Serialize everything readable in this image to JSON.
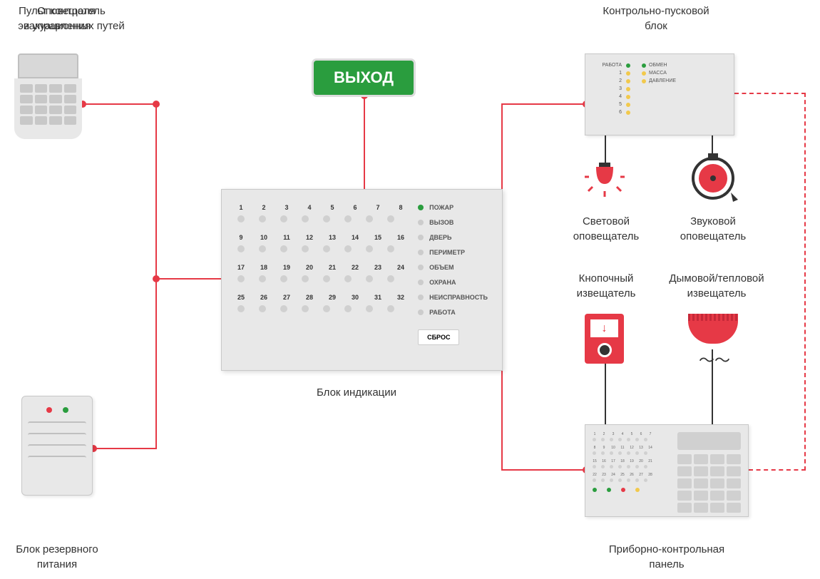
{
  "labels": {
    "control_panel_top": "Пульт контроля",
    "control_panel_top2": "и управления",
    "evac_notifier1": "Оповещатель",
    "evac_notifier2": "эвакуационных путей",
    "launch_block1": "Контрольно-пусковой",
    "launch_block2": "блок",
    "indication_block": "Блок индикации",
    "backup_power1": "Блок резервного",
    "backup_power2": "питания",
    "light_notifier1": "Световой",
    "light_notifier2": "оповещатель",
    "sound_notifier1": "Звуковой",
    "sound_notifier2": "оповещатель",
    "button_detector1": "Кнопочный",
    "button_detector2": "извещатель",
    "smoke_detector1": "Дымовой/тепловой",
    "smoke_detector2": "извещатель",
    "device_panel1": "Приборно-контрольная",
    "device_panel2": "панель"
  },
  "exit_sign": "ВЫХОД",
  "launch_block_labels": {
    "rabota": "РАБОТА",
    "obmen": "ОБМЕН",
    "massa": "МАССА",
    "davlenie": "ДАВЛЕНИЕ",
    "nums": [
      "1",
      "2",
      "3",
      "4",
      "5",
      "6"
    ]
  },
  "indication": {
    "numbers": [
      [
        "1",
        "2",
        "3",
        "4",
        "5",
        "6",
        "7",
        "8"
      ],
      [
        "9",
        "10",
        "11",
        "12",
        "13",
        "14",
        "15",
        "16"
      ],
      [
        "17",
        "18",
        "19",
        "20",
        "21",
        "22",
        "23",
        "24"
      ],
      [
        "25",
        "26",
        "27",
        "28",
        "29",
        "30",
        "31",
        "32"
      ]
    ],
    "statuses": [
      "ПОЖАР",
      "ВЫЗОВ",
      "ДВЕРЬ",
      "ПЕРИМЕТР",
      "ОБЪЕМ",
      "ОХРАНА",
      "НЕИСПРАВНОСТЬ",
      "РАБОТА"
    ],
    "reset": "СБРОС"
  },
  "call_point_arrow": "↓"
}
